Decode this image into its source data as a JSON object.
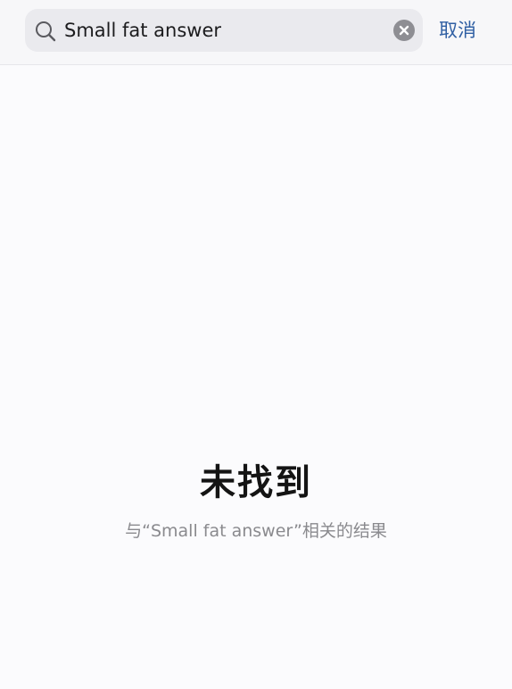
{
  "search": {
    "value": "Small fat answer",
    "placeholder": "",
    "icon": "search-icon",
    "clear_icon": "clear-icon"
  },
  "header": {
    "cancel_label": "取消"
  },
  "empty_state": {
    "title": "未找到",
    "subtitle": "与“Small fat answer”相关的结果"
  },
  "colors": {
    "accent": "#2f5fa3",
    "background": "#fbfbfd",
    "search_field_bg": "#eaeaee"
  }
}
